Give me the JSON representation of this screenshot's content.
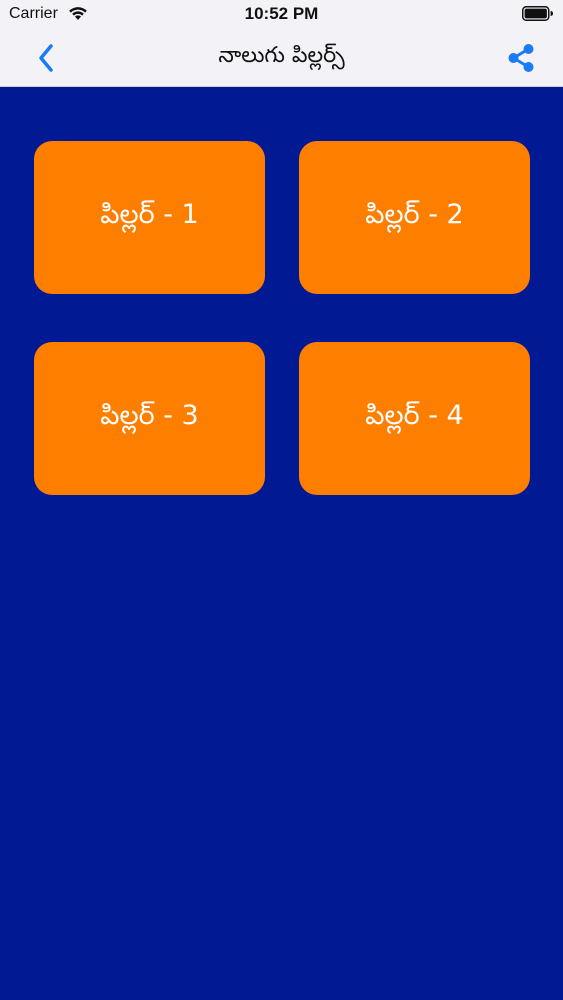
{
  "status_bar": {
    "carrier": "Carrier",
    "time": "10:52 PM",
    "wifi_icon": "wifi-icon",
    "battery_icon": "battery-icon"
  },
  "nav": {
    "title": "నాలుగు పిల్లర్స్",
    "back_icon": "chevron-left-icon",
    "share_icon": "share-icon"
  },
  "tiles": [
    {
      "label": "పిల్లర్ - 1"
    },
    {
      "label": "పిల్లర్ - 2"
    },
    {
      "label": "పిల్లర్ - 3"
    },
    {
      "label": "పిల్లర్ - 4"
    }
  ],
  "colors": {
    "background": "#021994",
    "tile": "#fe7e00",
    "tile_text": "#ffffff",
    "accent": "#1a7cf5",
    "nav_background": "#f3f2f7"
  }
}
